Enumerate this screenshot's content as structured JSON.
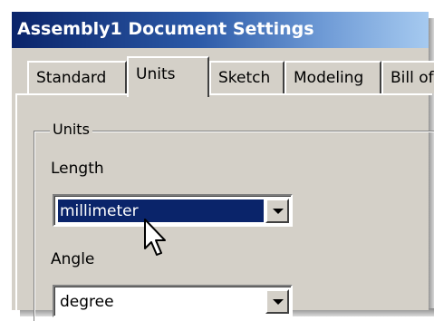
{
  "window": {
    "title": "Assembly1 Document Settings"
  },
  "tabs": [
    {
      "label": "Standard",
      "active": false
    },
    {
      "label": "Units",
      "active": true
    },
    {
      "label": "Sketch",
      "active": false
    },
    {
      "label": "Modeling",
      "active": false
    },
    {
      "label": "Bill of",
      "active": false
    }
  ],
  "units_group": {
    "legend": "Units",
    "length": {
      "label": "Length",
      "value": "millimeter",
      "selected": true
    },
    "angle": {
      "label": "Angle",
      "value": "degree",
      "selected": false
    }
  },
  "colors": {
    "title_start": "#0a246a",
    "title_end": "#a6caf0",
    "selection": "#0a246a",
    "face": "#d4d0c8"
  },
  "icons": {
    "combo_arrow": "chevron-down-icon",
    "pointer": "mouse-pointer-icon"
  }
}
